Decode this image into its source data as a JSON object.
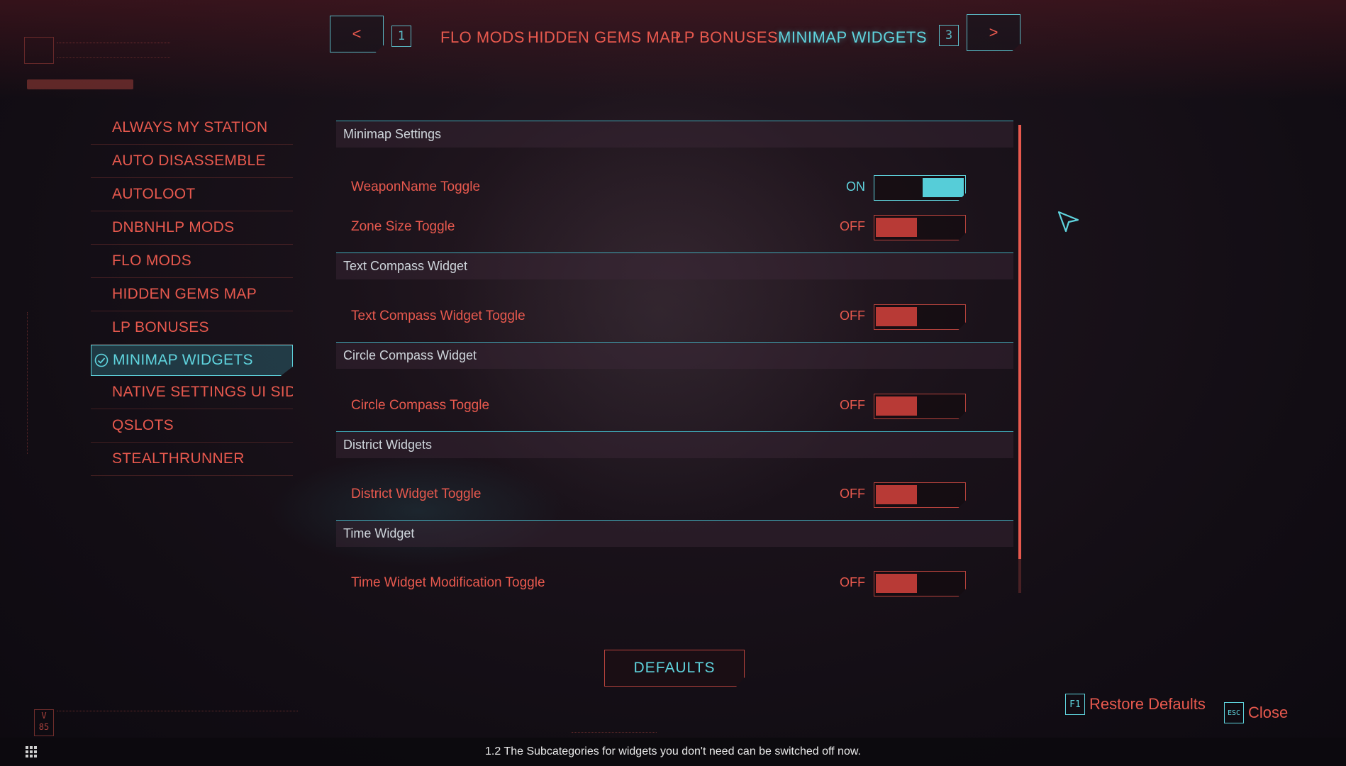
{
  "top_nav": {
    "prev_label": "<",
    "next_label": ">",
    "prev_page": "1",
    "next_page": "3",
    "tabs": [
      {
        "label": "FLO MODS",
        "active": false
      },
      {
        "label": "HIDDEN GEMS MAP",
        "active": false
      },
      {
        "label": "LP BONUSES",
        "active": false
      },
      {
        "label": "MINIMAP WIDGETS",
        "active": true
      }
    ]
  },
  "sidebar": {
    "items": [
      {
        "label": "ALWAYS MY STATION"
      },
      {
        "label": "AUTO DISASSEMBLE"
      },
      {
        "label": "AUTOLOOT"
      },
      {
        "label": "DNBNHLP MODS"
      },
      {
        "label": "FLO MODS"
      },
      {
        "label": "HIDDEN GEMS MAP"
      },
      {
        "label": "LP BONUSES"
      },
      {
        "label": "MINIMAP WIDGETS",
        "active": true
      },
      {
        "label": "NATIVE SETTINGS UI SIDE M"
      },
      {
        "label": "QSLOTS"
      },
      {
        "label": "STEALTHRUNNER"
      }
    ]
  },
  "sections": [
    {
      "title": "Minimap Settings",
      "rows": [
        {
          "label": "WeaponName Toggle",
          "state": "ON"
        },
        {
          "label": "Zone Size Toggle",
          "state": "OFF"
        }
      ]
    },
    {
      "title": "Text Compass Widget",
      "rows": [
        {
          "label": "Text Compass Widget Toggle",
          "state": "OFF"
        }
      ]
    },
    {
      "title": "Circle Compass Widget",
      "rows": [
        {
          "label": "Circle Compass Toggle",
          "state": "OFF"
        }
      ]
    },
    {
      "title": "District Widgets",
      "rows": [
        {
          "label": "District Widget Toggle",
          "state": "OFF"
        }
      ]
    },
    {
      "title": "Time Widget",
      "rows": [
        {
          "label": "Time Widget Modification Toggle",
          "state": "OFF"
        }
      ]
    }
  ],
  "defaults_label": "DEFAULTS",
  "hints": {
    "restore_key": "F1",
    "restore_label": "Restore Defaults",
    "close_key": "ESC",
    "close_label": "Close"
  },
  "hud": {
    "version": "V 85"
  },
  "caption": "1.2 The Subcategories for widgets you don't need can be switched off now.",
  "colors": {
    "accent_red": "#e8594e",
    "accent_cyan": "#5fd4de",
    "toggle_off": "#b83a36",
    "toggle_on": "#56cdd8"
  }
}
